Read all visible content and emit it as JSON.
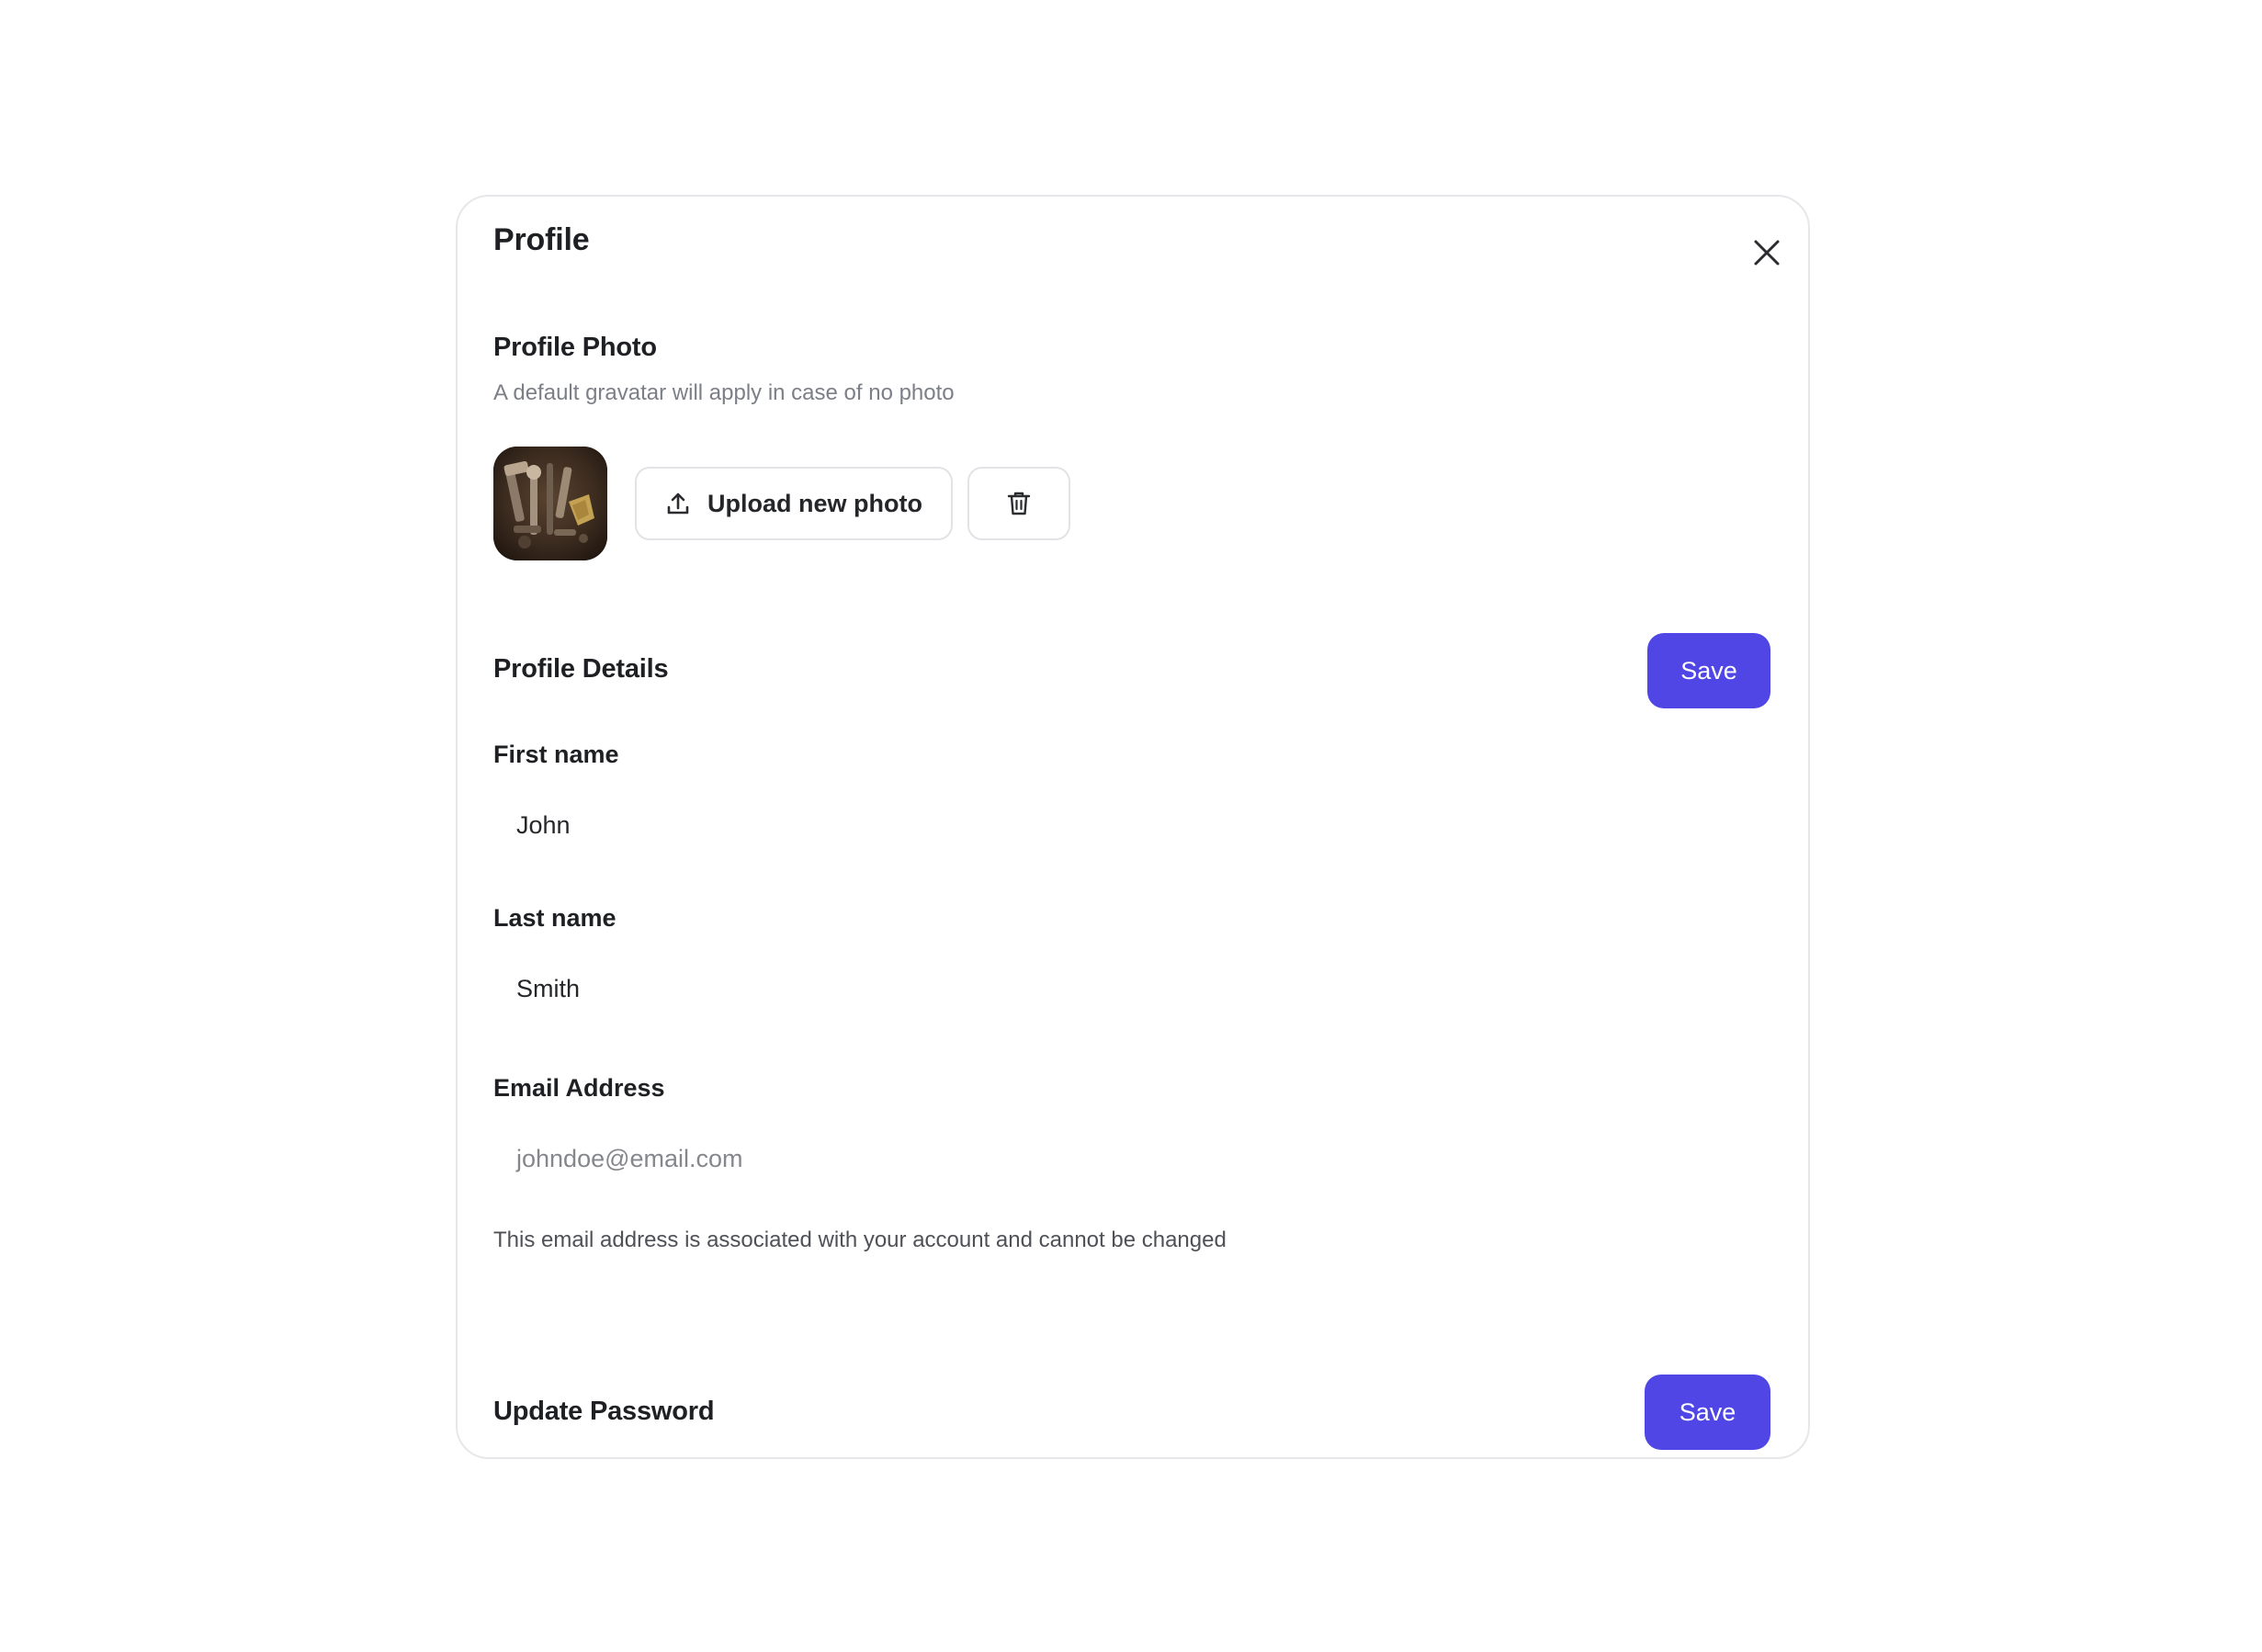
{
  "modal": {
    "title": "Profile"
  },
  "photo_section": {
    "title": "Profile Photo",
    "description": "A default gravatar will apply in case of no photo",
    "upload_label": "Upload new photo"
  },
  "details_section": {
    "title": "Profile Details",
    "save_label": "Save",
    "first_name": {
      "label": "First name",
      "value": "John"
    },
    "last_name": {
      "label": "Last name",
      "value": "Smith"
    },
    "email": {
      "label": "Email Address",
      "value": "johndoe@email.com",
      "helper": "This email address is associated with your account and cannot be changed"
    }
  },
  "password_section": {
    "title": "Update Password",
    "save_label": "Save"
  },
  "colors": {
    "accent": "#4f46e5",
    "border": "#e6e7ea",
    "muted_text": "#7c7f86"
  },
  "icons": {
    "close": "close-icon",
    "upload": "upload-icon",
    "delete": "trash-icon"
  }
}
